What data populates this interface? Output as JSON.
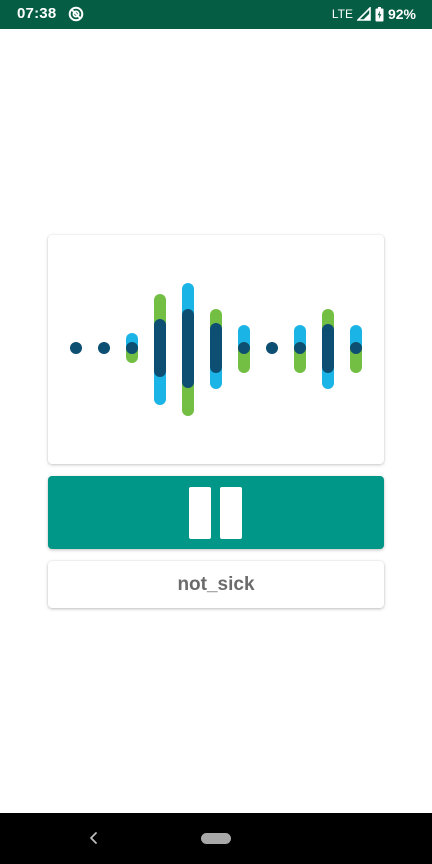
{
  "status_bar": {
    "time": "07:38",
    "network": "LTE",
    "battery": "92%",
    "icons": [
      "app-notification-icon",
      "signal-icon",
      "battery-icon"
    ]
  },
  "waveform": {
    "icon": "audio-waveform-icon",
    "colors": {
      "dark": "#0d4f73",
      "blue": "#1ab4e6",
      "green": "#72bf44"
    }
  },
  "controls": {
    "pause_icon": "pause-icon",
    "pause_color": "#009688"
  },
  "result": {
    "label": "not_sick"
  },
  "nav_bar": {
    "icons": [
      "back-icon",
      "home-icon"
    ]
  },
  "colors": {
    "status_bar": "#055d44",
    "background": "#ffffff",
    "result_text": "#6b6b6b"
  }
}
